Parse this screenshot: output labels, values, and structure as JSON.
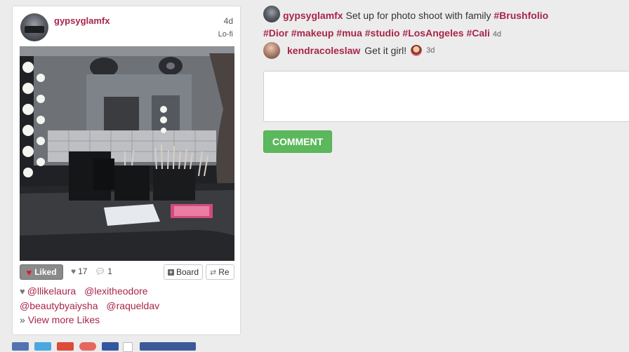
{
  "post": {
    "username": "gypsyglamfx",
    "time_ago": "4d",
    "filter": "Lo-fi",
    "actions": {
      "liked_label": "Liked",
      "like_count": "17",
      "comment_count": "1",
      "board_label": "Board",
      "repost_label": "Re"
    },
    "likers": [
      "@llikelaura",
      "@lexitheodore",
      "@beautybyaiysha",
      "@raqueldav"
    ],
    "view_more_label": "View more Likes"
  },
  "caption": {
    "username": "gypsyglamfx",
    "text": "Set up for photo shoot with family",
    "tags": [
      "#Brushfolio",
      "#Dior",
      "#makeup",
      "#mua",
      "#studio",
      "#LosAngeles",
      "#Cali"
    ],
    "time_ago": "4d"
  },
  "comments": [
    {
      "username": "kendracoleslaw",
      "text": "Get it girl!",
      "time_ago": "3d",
      "emoji": "girl-emoji"
    }
  ],
  "comment_form": {
    "value": "",
    "button_label": "COMMENT"
  },
  "colors": {
    "link": "#a8254a",
    "comment_button": "#5cb85c",
    "liked_button": "#8a8a8a",
    "heart": "#e0162b"
  }
}
